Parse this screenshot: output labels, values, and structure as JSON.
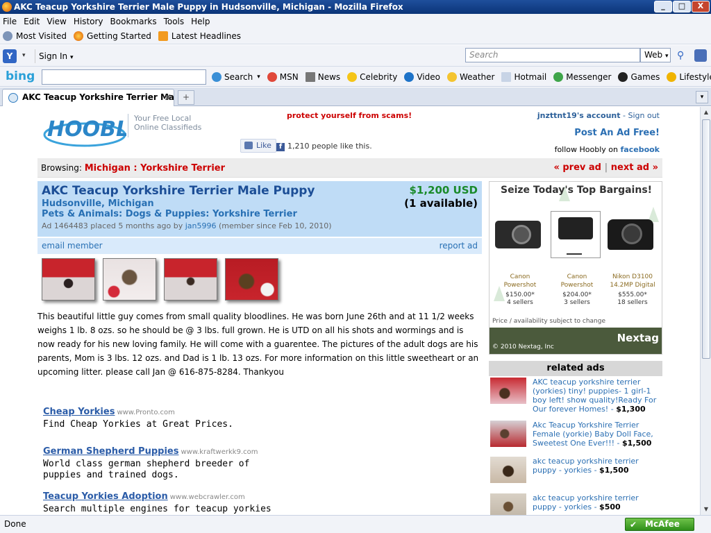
{
  "window": {
    "title": "AKC Teacup Yorkshire Terrier Male Puppy in Hudsonville, Michigan - Mozilla Firefox",
    "min": "_",
    "max": "□",
    "close": "X"
  },
  "menu": [
    "File",
    "Edit",
    "View",
    "History",
    "Bookmarks",
    "Tools",
    "Help"
  ],
  "bookmarks": [
    "Most Visited",
    "Getting Started",
    "Latest Headlines"
  ],
  "navbar": {
    "signin": "Sign In",
    "search_placeholder": "Search",
    "engine": "Web"
  },
  "bing": {
    "logo": "bing",
    "items": [
      "Search",
      "MSN",
      "News",
      "Celebrity",
      "Video",
      "Weather",
      "Hotmail",
      "Messenger",
      "Games",
      "Lifestyle"
    ]
  },
  "tab": {
    "label": "AKC Teacup Yorkshire Terrier Male P...",
    "close": "x",
    "newtab": "+"
  },
  "page": {
    "logo_text": "HOOBLY",
    "tagline_1": "Your Free Local",
    "tagline_2": "Online Classifieds",
    "scam_warning": "protect yourself from scams!",
    "account": "jnzttnt19's account",
    "signout": "Sign out",
    "post_ad": "Post An Ad Free!",
    "follow_text": "follow Hoobly on",
    "facebook": "facebook",
    "like": "Like",
    "like_count": "1,210 people like this.",
    "browsing_label": "Browsing:",
    "browsing_path": "Michigan : Yorkshire Terrier",
    "prev": "« prev ad",
    "sep": "|",
    "next": "next ad »",
    "ad_title": "AKC Teacup Yorkshire Terrier Male Puppy",
    "ad_location": "Hudsonville, Michigan",
    "ad_category": "Pets & Animals: Dogs & Puppies: Yorkshire Terrier",
    "ad_meta_1": "Ad 1464483 placed 5 months ago by",
    "ad_user": "jan5996",
    "ad_meta_2": "(member since Feb 10, 2010)",
    "price": "$1,200 USD",
    "available": "(1 available)",
    "email_member": "email member",
    "report_ad": "report ad",
    "description": "This beautiful little guy comes from small quality bloodlines. He was born June 26th and at 11 1/2 weeks weighs 1 lb. 8 ozs. so he should be @ 3 lbs. full grown. He is UTD on all his shots and wormings and is now ready for his new loving family. He will come with a guarentee. The pictures of the adult dogs are his parents, Mom is 3 lbs. 12 ozs. and Dad is 1 lb. 13 ozs. For more information on this little sweetheart or an upcoming litter. please call Jan @ 616-875-8284. Thankyou"
  },
  "sponsored": [
    {
      "title": "Cheap Yorkies",
      "url": "www.Pronto.com",
      "desc": "Find Cheap Yorkies at Great Prices."
    },
    {
      "title": "German Shepherd Puppies",
      "url": "www.kraftwerkk9.com",
      "desc": "World class german shepherd breeder of puppies and trained dogs."
    },
    {
      "title": "Teacup Yorkies Adoption",
      "url": "www.webcrawler.com",
      "desc": "Search multiple engines for teacup yorkies"
    }
  ],
  "nextag": {
    "heading": "Seize Today's Top Bargains!",
    "items": [
      {
        "name1": "Canon",
        "name2": "Powershot",
        "price": "$150.00*",
        "sellers": "4 sellers"
      },
      {
        "name1": "Canon",
        "name2": "Powershot",
        "price": "$204.00*",
        "sellers": "3 sellers"
      },
      {
        "name1": "Nikon D3100",
        "name2": "14.2MP Digital",
        "price": "$555.00*",
        "sellers": "18 sellers"
      }
    ],
    "disclaimer": "Price / availability subject to change",
    "copyright": "© 2010 Nextag, Inc",
    "logo": "Nextag"
  },
  "related": {
    "heading": "related ads",
    "items": [
      {
        "text": "AKC teacup yorkshire terrier (yorkies) tiny! puppies- 1 girl-1 boy left! show quality!Ready For Our forever Homes! -",
        "price": "$1,300"
      },
      {
        "text": "Akc Teacup Yorkshire Terrier Female (yorkie) Baby Doll Face, Sweetest One Ever!!! -",
        "price": "$1,500"
      },
      {
        "text": "akc teacup yorkshire terrier puppy - yorkies -",
        "price": "$1,500"
      },
      {
        "text": "akc teacup yorkshire terrier puppy - yorkies -",
        "price": "$500"
      }
    ]
  },
  "status": {
    "text": "Done",
    "mcafee": "McAfee"
  }
}
